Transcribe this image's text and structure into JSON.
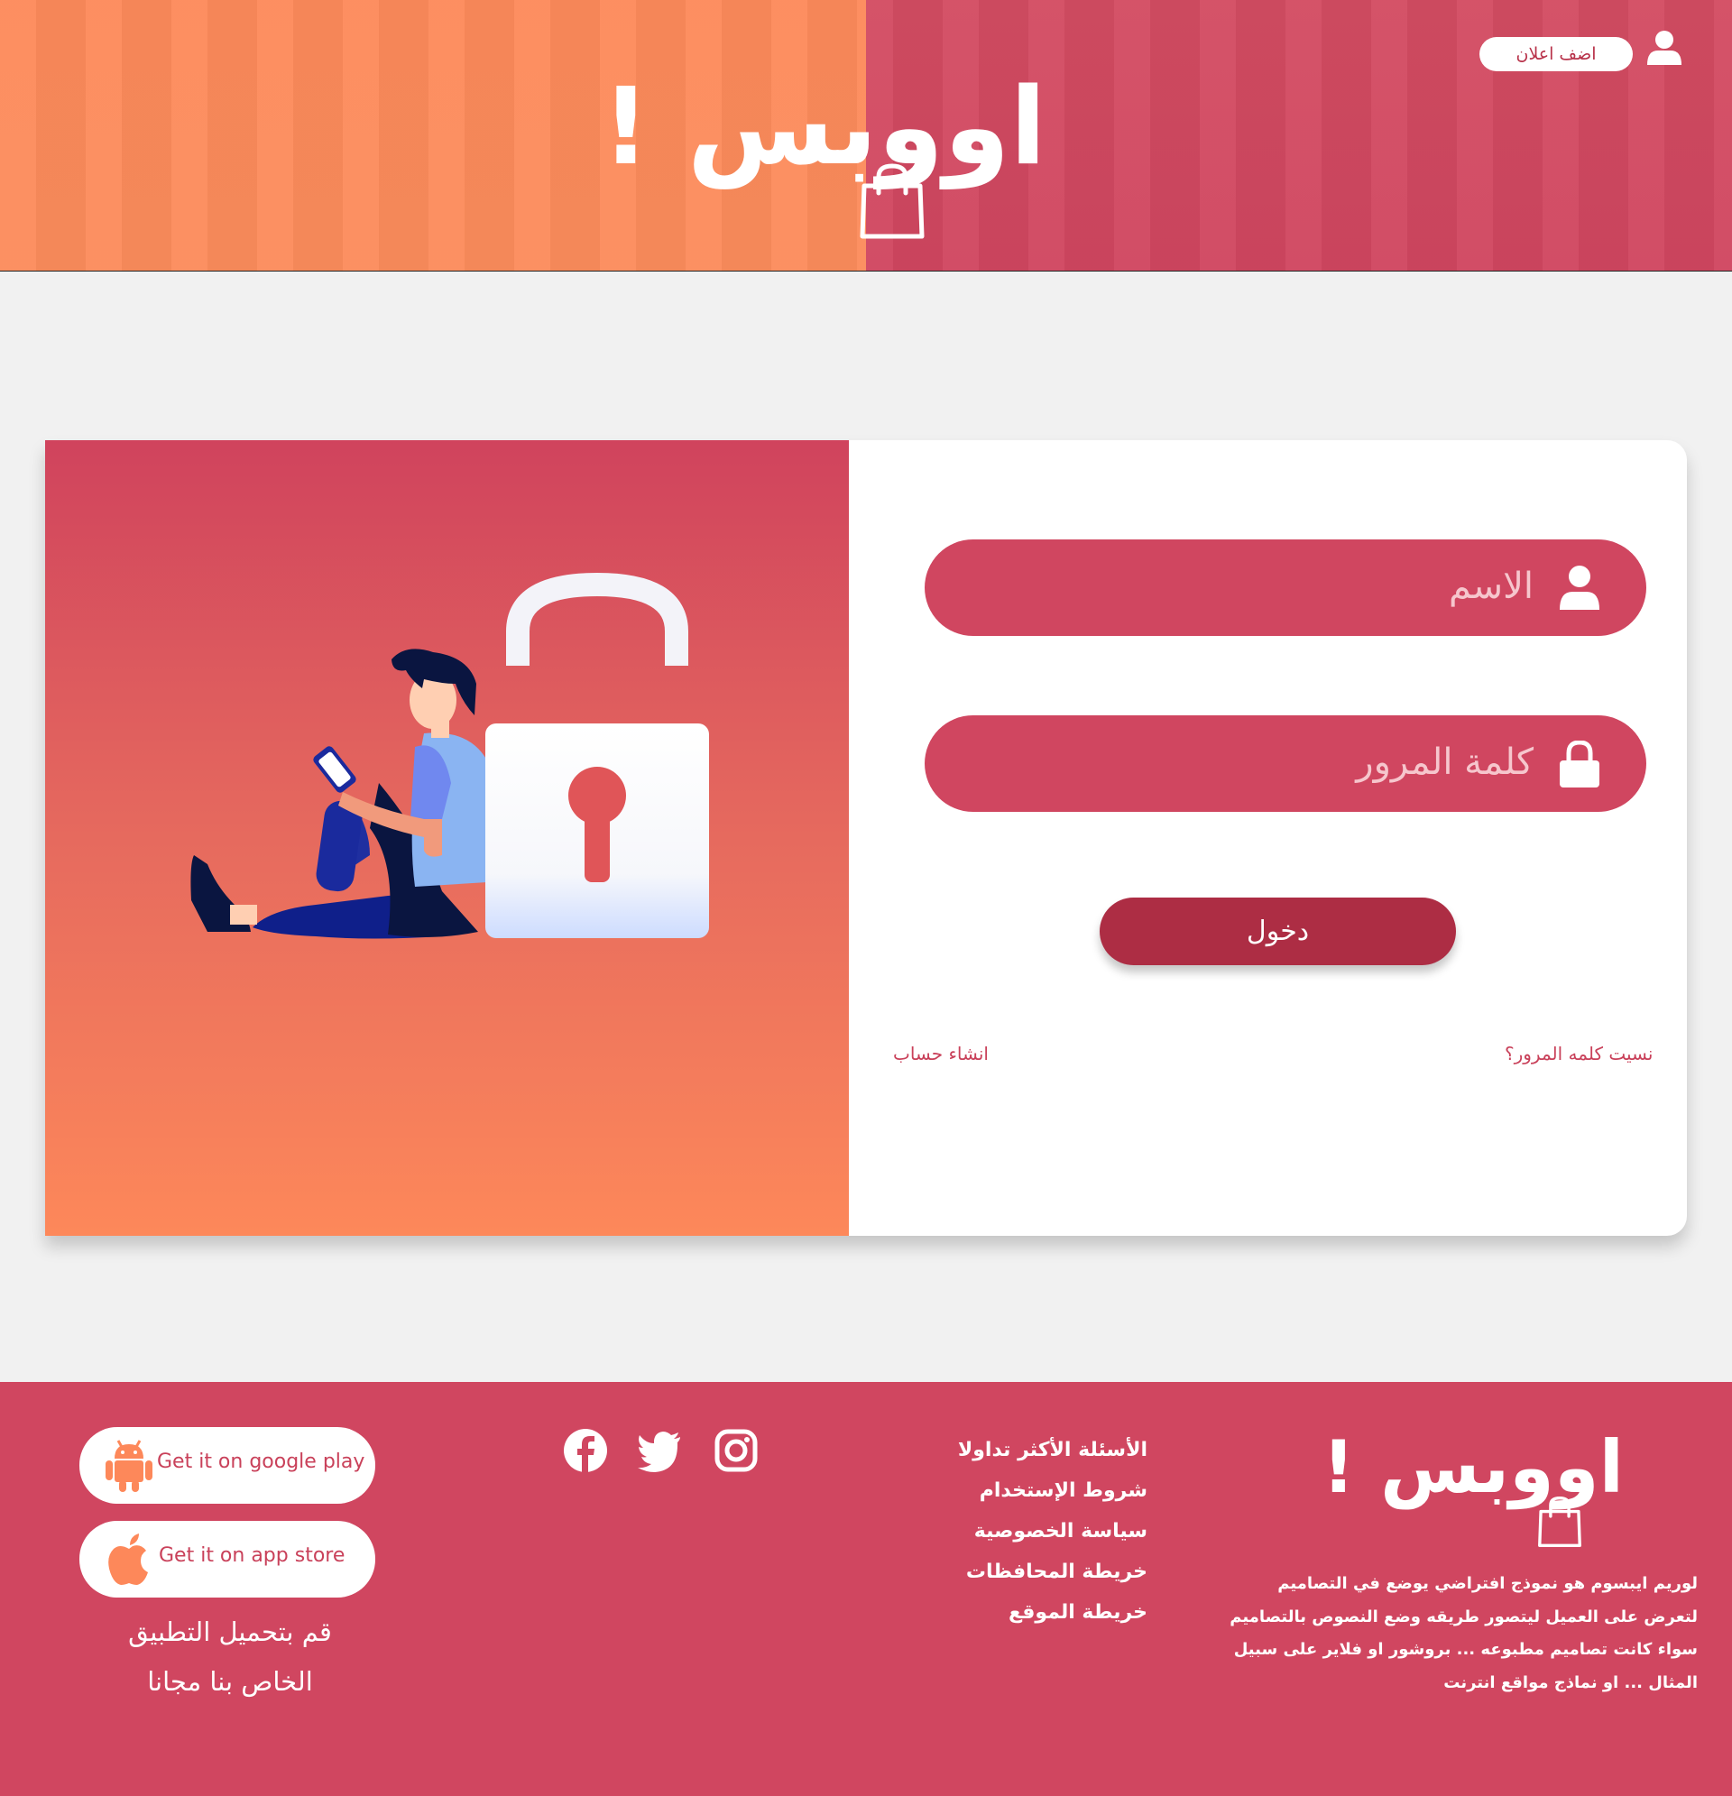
{
  "colors": {
    "brand_red": "#d04660",
    "brand_orange": "#fd885a",
    "button_dark_red": "#ad2d44",
    "page_bg": "#f1f1f1"
  },
  "header": {
    "logo_text": "اووبس !",
    "logo_icon": "shopping-bag-icon",
    "add_ad_label": "اضف اعلان",
    "user_icon": "user-icon"
  },
  "login": {
    "name_placeholder": "الاسم",
    "name_icon": "user-icon",
    "password_placeholder": "كلمة المرور",
    "password_icon": "lock-icon",
    "submit_label": "دخول",
    "forgot_password": "نسيت كلمه المرور؟",
    "create_account": "انشاء حساب",
    "illustration": "person-with-phone-and-padlock"
  },
  "footer": {
    "logo_text": "اووبس !",
    "description": "لوريم ايبسوم هو نموذج افتراضي يوضع في التصاميم لتعرض على العميل ليتصور طريقه وضع النصوص بالتصاميم سواء كانت تصاميم مطبوعه ... بروشور او فلاير على سبيل المثال ... او نماذج مواقع انترنت",
    "links": [
      "الأسئلة الأكثر تداولا",
      "شروط الإستخدام",
      "سياسة الخصوصية",
      "خريطة المحافظات",
      "خريطة الموقع"
    ],
    "social": [
      "instagram-icon",
      "twitter-icon",
      "facebook-icon"
    ],
    "google_play_label": "Get it on google play",
    "app_store_label": "Get it on app store",
    "download_line1": "قم بتحميل التطبيق",
    "download_line2": "الخاص بنا مجانا"
  }
}
